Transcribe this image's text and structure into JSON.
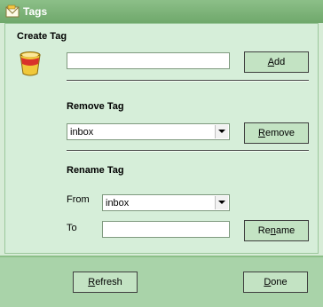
{
  "window": {
    "title": "Tags"
  },
  "create": {
    "heading": "Create Tag",
    "input_value": "",
    "add_label_pre": "",
    "add_label_acc": "A",
    "add_label_post": "dd"
  },
  "remove": {
    "heading": "Remove Tag",
    "selected": "inbox",
    "button_pre": "",
    "button_acc": "R",
    "button_post": "emove"
  },
  "rename": {
    "heading": "Rename Tag",
    "from_label": "From",
    "from_selected": "inbox",
    "to_label": "To",
    "to_value": "",
    "button_pre": "Re",
    "button_acc": "n",
    "button_post": "ame"
  },
  "footer": {
    "refresh_pre": "",
    "refresh_acc": "R",
    "refresh_post": "efresh",
    "done_pre": "",
    "done_acc": "D",
    "done_post": "one"
  },
  "icons": {
    "title": "envelope-icon",
    "tag_bucket": "bucket-icon"
  },
  "colors": {
    "titlebar": "#7bb377",
    "panel": "#d6eed9",
    "footer": "#a9d3a9",
    "button": "#c3e3c3"
  }
}
